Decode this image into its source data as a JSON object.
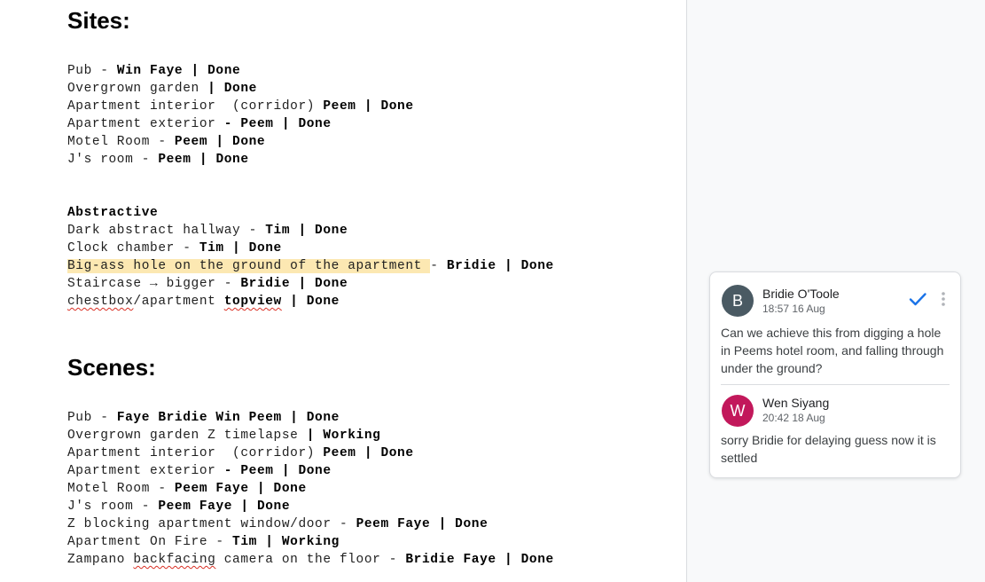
{
  "document": {
    "sites": {
      "heading": "Sites:",
      "lines": [
        {
          "plain": "Pub - ",
          "bold": "Win Faye | Done"
        },
        {
          "plain": "Overgrown garden ",
          "bold": "| Done"
        },
        {
          "plain": "Apartment interior  (corridor) ",
          "bold": "Peem | Done"
        },
        {
          "plain": "Apartment exterior ",
          "bold": "- Peem | Done"
        },
        {
          "plain": "Motel Room - ",
          "bold": "Peem | Done"
        },
        {
          "plain": "J's room - ",
          "bold": "Peem | Done"
        }
      ]
    },
    "abstractive": {
      "title": "Abstractive",
      "line1": {
        "plain": "Dark abstract hallway - ",
        "bold": "Tim | Done"
      },
      "line2": {
        "plain": "Clock chamber - ",
        "bold": "Tim | Done"
      },
      "line3": {
        "highlighted": "Big-ass hole on the ground of the apartment ",
        "plain": "- ",
        "bold": "Bridie | Done"
      },
      "line4": {
        "plain": "Staircase → bigger - ",
        "bold": "Bridie | Done"
      },
      "line5": {
        "misspelled": "chestbox",
        "plain": "/apartment ",
        "bold_misspelled": "topview",
        "bold": " | Done"
      }
    },
    "scenes": {
      "heading": "Scenes:",
      "lines": [
        {
          "plain": "Pub - ",
          "bold": "Faye Bridie Win Peem | Done"
        },
        {
          "plain": "Overgrown garden Z timelapse ",
          "bold": "| Working"
        },
        {
          "plain": "Apartment interior  (corridor) ",
          "bold": "Peem | Done"
        },
        {
          "plain": "Apartment exterior ",
          "bold": "- Peem | Done"
        },
        {
          "plain": "Motel Room - ",
          "bold": "Peem Faye | Done"
        },
        {
          "plain": "J's room - ",
          "bold": "Peem Faye | Done"
        },
        {
          "plain": "Z blocking apartment window/door - ",
          "bold": "Peem Faye | Done"
        },
        {
          "plain": "Apartment On Fire - ",
          "bold": "Tim | Working"
        }
      ],
      "last_line": {
        "plain_a": "Zampano ",
        "misspelled": "backfacing",
        "plain_b": " camera on the floor - ",
        "bold": "Bridie Faye | Done"
      }
    }
  },
  "comment_thread": {
    "comments": [
      {
        "initial": "B",
        "author": "Bridie O'Toole",
        "timestamp": "18:57 16 Aug",
        "text": "Can we achieve this from digging a hole in Peems hotel room, and falling through under the ground?",
        "avatar_color": "#4a5a63"
      },
      {
        "initial": "W",
        "author": "Wen Siyang",
        "timestamp": "20:42 18 Aug",
        "text": "sorry Bridie for delaying guess now it is settled",
        "avatar_color": "#c2185b"
      }
    ],
    "resolve_icon": "checkmark-icon",
    "more_icon": "more-vert-icon",
    "accent_color": "#1a73e8"
  }
}
